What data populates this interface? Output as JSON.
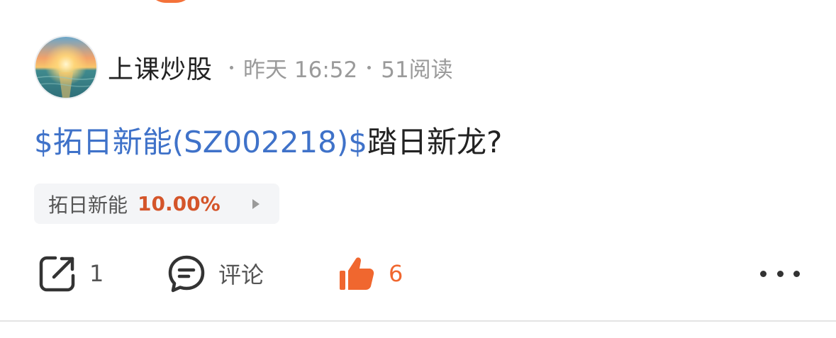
{
  "post": {
    "author": {
      "name": "上课炒股",
      "avatar": "sunset-sea-avatar"
    },
    "time": "昨天 16:52",
    "reads": "51阅读",
    "stock_link": "$拓日新能(SZ002218)$",
    "text": "踏日新龙?",
    "stock_chip": {
      "name": "拓日新能",
      "change": "10.00%",
      "change_color": "#d4552a",
      "arrow_icon": "play-arrow-icon"
    }
  },
  "actions": {
    "share": {
      "icon": "share-icon",
      "label": "1"
    },
    "comment": {
      "icon": "comment-icon",
      "label": "评论"
    },
    "like": {
      "icon": "thumbs-up-icon",
      "label": "6",
      "color": "#f0672f"
    },
    "more": {
      "icon": "more-icon"
    }
  },
  "colors": {
    "link": "#3f72c9",
    "accent": "#f0672f",
    "muted_text": "#9a9a9a"
  }
}
